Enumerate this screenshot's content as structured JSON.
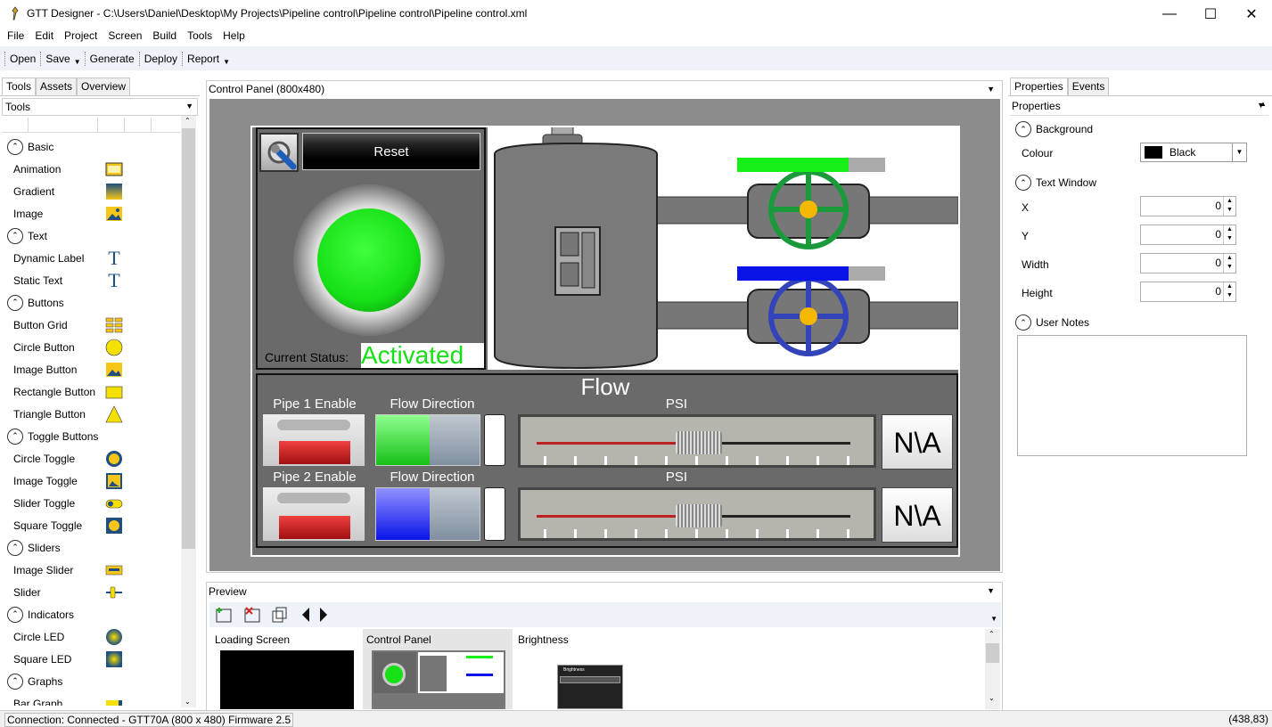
{
  "window": {
    "title": "GTT Designer - C:\\Users\\Daniel\\Desktop\\My Projects\\Pipeline control\\Pipeline control\\Pipeline control.xml"
  },
  "menu": [
    "File",
    "Edit",
    "Project",
    "Screen",
    "Build",
    "Tools",
    "Help"
  ],
  "toolbar": {
    "open": "Open",
    "save": "Save",
    "generate": "Generate",
    "deploy": "Deploy",
    "report": "Report"
  },
  "left": {
    "tabs": [
      "Tools",
      "Assets",
      "Overview"
    ],
    "combo": "Tools",
    "categories": {
      "basic": "Basic",
      "text": "Text",
      "buttons": "Buttons",
      "toggle": "Toggle Buttons",
      "sliders": "Sliders",
      "indicators": "Indicators",
      "graphs": "Graphs"
    },
    "items": {
      "animation": "Animation",
      "gradient": "Gradient",
      "image": "Image",
      "dynamic_label": "Dynamic Label",
      "static_text": "Static Text",
      "button_grid": "Button Grid",
      "circle_button": "Circle Button",
      "image_button": "Image Button",
      "rectangle_button": "Rectangle Button",
      "triangle_button": "Triangle Button",
      "circle_toggle": "Circle Toggle",
      "image_toggle": "Image Toggle",
      "slider_toggle": "Slider Toggle",
      "square_toggle": "Square Toggle",
      "image_slider": "Image Slider",
      "slider": "Slider",
      "circle_led": "Circle LED",
      "square_led": "Square LED",
      "bar_graph": "Bar Graph"
    }
  },
  "center": {
    "header": "Control Panel (800x480)",
    "panel": {
      "reset": "Reset",
      "status_label": "Current Status:",
      "status_value": "Activated",
      "flow": "Flow",
      "pipe1": "Pipe 1 Enable",
      "pipe2": "Pipe 2 Enable",
      "flow_dir1": "Flow Direction",
      "flow_dir2": "Flow Direction",
      "psi1": "PSI",
      "psi2": "PSI",
      "na1": "N\\A",
      "na2": "N\\A"
    }
  },
  "preview": {
    "header": "Preview",
    "screens": [
      "Loading Screen",
      "Control Panel",
      "Brightness"
    ],
    "brightness_thumb_title": "Brightness"
  },
  "right": {
    "tabs": [
      "Properties",
      "Events"
    ],
    "combo": "Properties",
    "background": "Background",
    "colour_label": "Colour",
    "colour_value": "Black",
    "text_window": "Text Window",
    "x_label": "X",
    "x_value": "0",
    "y_label": "Y",
    "y_value": "0",
    "width_label": "Width",
    "width_value": "0",
    "height_label": "Height",
    "height_value": "0",
    "user_notes": "User Notes"
  },
  "status": {
    "connection": "Connection: Connected - GTT70A (800 x 480) Firmware 2.5",
    "coords": "(438,83)"
  },
  "colors": {
    "led_green": "#16e016",
    "flow_blue": "#0a14e8",
    "valve_green": "#1a9a3a",
    "valve_blue": "#3344bb"
  }
}
